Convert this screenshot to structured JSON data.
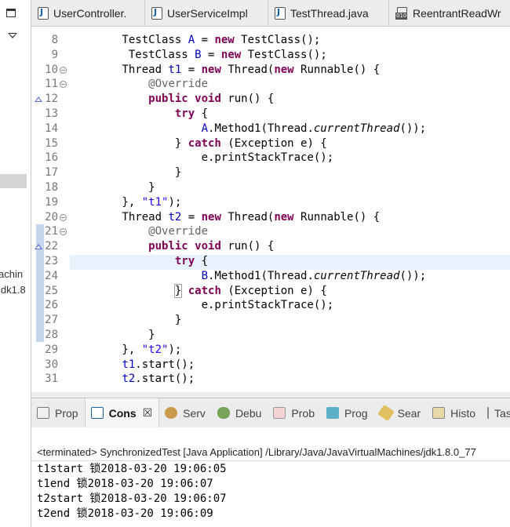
{
  "left_panel": {
    "texts": [
      "achin",
      "jdk1.8"
    ]
  },
  "editor_tabs": [
    {
      "label": "UserController.",
      "icon": "java-file-icon"
    },
    {
      "label": "UserServiceImpl",
      "icon": "java-file-icon"
    },
    {
      "label": "TestThread.java",
      "icon": "java-file-icon"
    },
    {
      "label": "ReentrantReadWr",
      "icon": "class-file-icon"
    }
  ],
  "editor": {
    "lines": [
      {
        "num": "8",
        "code": "        TestClass A = new TestClass();"
      },
      {
        "num": "9",
        "code": "         TestClass B = new TestClass();"
      },
      {
        "num": "10",
        "code": "        Thread t1 = new Thread(new Runnable() {"
      },
      {
        "num": "11",
        "code": "            @Override"
      },
      {
        "num": "12",
        "code": "            public void run() {"
      },
      {
        "num": "13",
        "code": "                try {"
      },
      {
        "num": "14",
        "code": "                    A.Method1(Thread.currentThread());"
      },
      {
        "num": "15",
        "code": "                } catch (Exception e) {"
      },
      {
        "num": "16",
        "code": "                    e.printStackTrace();"
      },
      {
        "num": "17",
        "code": "                }"
      },
      {
        "num": "18",
        "code": "            }"
      },
      {
        "num": "19",
        "code": "        }, \"t1\");"
      },
      {
        "num": "20",
        "code": "        Thread t2 = new Thread(new Runnable() {"
      },
      {
        "num": "21",
        "code": "            @Override"
      },
      {
        "num": "22",
        "code": "            public void run() {"
      },
      {
        "num": "23",
        "code": "                try {"
      },
      {
        "num": "24",
        "code": "                    B.Method1(Thread.currentThread());"
      },
      {
        "num": "25",
        "code": "                } catch (Exception e) {"
      },
      {
        "num": "26",
        "code": "                    e.printStackTrace();"
      },
      {
        "num": "27",
        "code": "                }"
      },
      {
        "num": "28",
        "code": "            }"
      },
      {
        "num": "29",
        "code": "        }, \"t2\");"
      },
      {
        "num": "30",
        "code": "        t1.start();"
      },
      {
        "num": "31",
        "code": "        t2.start();"
      }
    ]
  },
  "view_tabs": [
    {
      "label": "Prop",
      "icon": "properties-icon",
      "active": false
    },
    {
      "label": "Cons",
      "icon": "console-icon",
      "active": true
    },
    {
      "label": "Serv",
      "icon": "servers-icon",
      "active": false
    },
    {
      "label": "Debu",
      "icon": "debug-icon",
      "active": false
    },
    {
      "label": "Prob",
      "icon": "problems-icon",
      "active": false
    },
    {
      "label": "Prog",
      "icon": "progress-icon",
      "active": false
    },
    {
      "label": "Sear",
      "icon": "search-icon",
      "active": false
    },
    {
      "label": "Histo",
      "icon": "history-icon",
      "active": false
    },
    {
      "label": "Tas",
      "icon": "tasks-icon",
      "active": false
    }
  ],
  "console": {
    "status": "<terminated> SynchronizedTest [Java Application] /Library/Java/JavaVirtualMachines/jdk1.8.0_77",
    "output": [
      "t1start 锁2018-03-20 19:06:05",
      "t1end 锁2018-03-20 19:06:07",
      "t2start 锁2018-03-20 19:06:07",
      "t2end 锁2018-03-20 19:06:09"
    ]
  },
  "colors": {
    "keyword": "#7f0055",
    "annotation": "#646464",
    "string": "#2a00ff",
    "field": "#0000c0"
  }
}
